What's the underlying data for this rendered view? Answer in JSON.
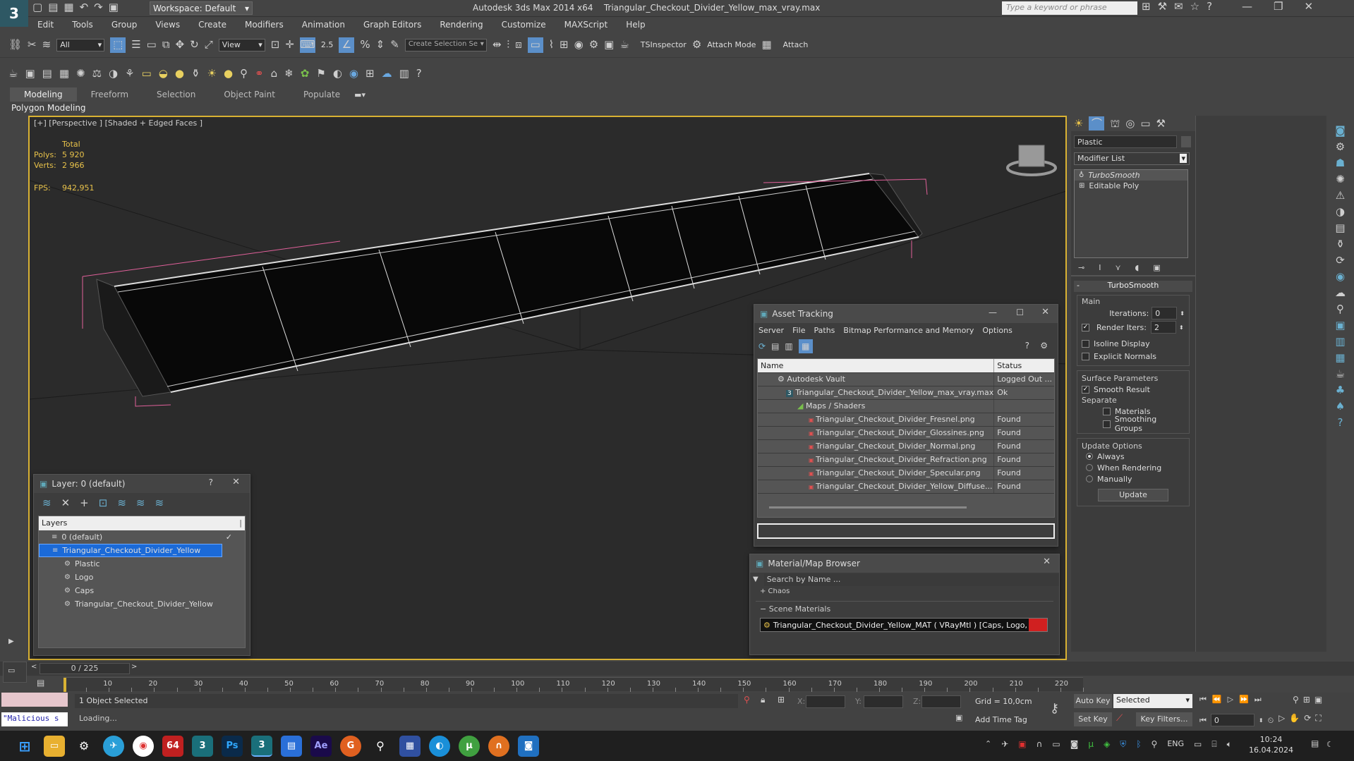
{
  "app": {
    "title": "Autodesk 3ds Max  2014 x64",
    "file": "Triangular_Checkout_Divider_Yellow_max_vray.max",
    "workspace": "Workspace: Default",
    "search_placeholder": "Type a keyword or phrase",
    "logo_letter": "3"
  },
  "menu": [
    "Edit",
    "Tools",
    "Group",
    "Views",
    "Create",
    "Modifiers",
    "Animation",
    "Graph Editors",
    "Rendering",
    "Customize",
    "MAXScript",
    "Help"
  ],
  "toolbar": {
    "selection_filter": "All",
    "ref_coord": "View",
    "snap_value": "2.5",
    "named_selection": "Create Selection Se",
    "tsinspector": "TSInspector",
    "attach_mode": "Attach Mode",
    "attach": "Attach"
  },
  "ribbon": {
    "tabs": [
      "Modeling",
      "Freeform",
      "Selection",
      "Object Paint",
      "Populate"
    ],
    "sub": "Polygon Modeling"
  },
  "viewport": {
    "label": "[+] [Perspective ] [Shaded + Edged Faces ]",
    "stats": {
      "total_label": "Total",
      "polys_label": "Polys:",
      "polys": "5 920",
      "verts_label": "Verts:",
      "verts": "2 966",
      "fps_label": "FPS:",
      "fps": "942,951"
    }
  },
  "layer_panel": {
    "title": "Layer: 0 (default)",
    "header": "Layers",
    "rows": [
      {
        "name": "0 (default)"
      },
      {
        "name": "Triangular_Checkout_Divider_Yellow"
      },
      {
        "name": "Plastic"
      },
      {
        "name": "Logo"
      },
      {
        "name": "Caps"
      },
      {
        "name": "Triangular_Checkout_Divider_Yellow"
      }
    ]
  },
  "asset_tracking": {
    "title": "Asset Tracking",
    "menu": [
      "Server",
      "File",
      "Paths",
      "Bitmap Performance and Memory",
      "Options"
    ],
    "col_name": "Name",
    "col_status": "Status",
    "rows": [
      {
        "name": "Autodesk Vault",
        "status": "Logged Out ..."
      },
      {
        "name": "Triangular_Checkout_Divider_Yellow_max_vray.max",
        "status": "Ok"
      },
      {
        "name": "Maps / Shaders",
        "status": ""
      },
      {
        "name": "Triangular_Checkout_Divider_Fresnel.png",
        "status": "Found"
      },
      {
        "name": "Triangular_Checkout_Divider_Glossines.png",
        "status": "Found"
      },
      {
        "name": "Triangular_Checkout_Divider_Normal.png",
        "status": "Found"
      },
      {
        "name": "Triangular_Checkout_Divider_Refraction.png",
        "status": "Found"
      },
      {
        "name": "Triangular_Checkout_Divider_Specular.png",
        "status": "Found"
      },
      {
        "name": "Triangular_Checkout_Divider_Yellow_Diffuse...",
        "status": "Found"
      }
    ]
  },
  "mat_browser": {
    "title": "Material/Map Browser",
    "search_placeholder": "Search by Name ...",
    "chaos": "+ Chaos",
    "section": "Scene Materials",
    "item": "Triangular_Checkout_Divider_Yellow_MAT ( VRayMtl ) [Caps, Logo, Plast..."
  },
  "command_panel": {
    "object_name": "Plastic",
    "modifier_list": "Modifier List",
    "stack": [
      "TurboSmooth",
      "Editable Poly"
    ],
    "turbosmooth": {
      "title": "TurboSmooth",
      "main": "Main",
      "iterations_label": "Iterations:",
      "iterations": "0",
      "render_iters_label": "Render Iters:",
      "render_iters": "2",
      "isoline": "Isoline Display",
      "explicit_normals": "Explicit Normals",
      "surface_params": "Surface Parameters",
      "smooth_result": "Smooth Result",
      "separate": "Separate",
      "materials": "Materials",
      "smoothing_groups": "Smoothing Groups",
      "update_options": "Update Options",
      "always": "Always",
      "when_rendering": "When Rendering",
      "manually": "Manually",
      "update": "Update"
    }
  },
  "timeline": {
    "frame": "0 / 225",
    "ticks": [
      "10",
      "20",
      "30",
      "40",
      "50",
      "60",
      "70",
      "80",
      "90",
      "100",
      "110",
      "120",
      "130",
      "140",
      "150",
      "160",
      "170",
      "180",
      "190",
      "200",
      "210",
      "220"
    ]
  },
  "status": {
    "script_box": "\"Malicious s",
    "selected": "1 Object Selected",
    "loading": "Loading...",
    "x_label": "X:",
    "y_label": "Y:",
    "z_label": "Z:",
    "grid": "Grid = 10,0cm",
    "add_time_tag": "Add Time Tag",
    "auto_key": "Auto Key",
    "set_key": "Set Key",
    "key_mode": "Selected",
    "key_filters": "Key Filters...",
    "frame_field": "0"
  },
  "taskbar": {
    "lang": "ENG",
    "time": "10:24",
    "date": "16.04.2024",
    "badge": "64"
  },
  "colors": {
    "viewport_border": "#d9b233",
    "selection_blue": "#1b6ad8",
    "selection_pink": "#e0609a",
    "stat_yellow": "#e8c24a"
  }
}
